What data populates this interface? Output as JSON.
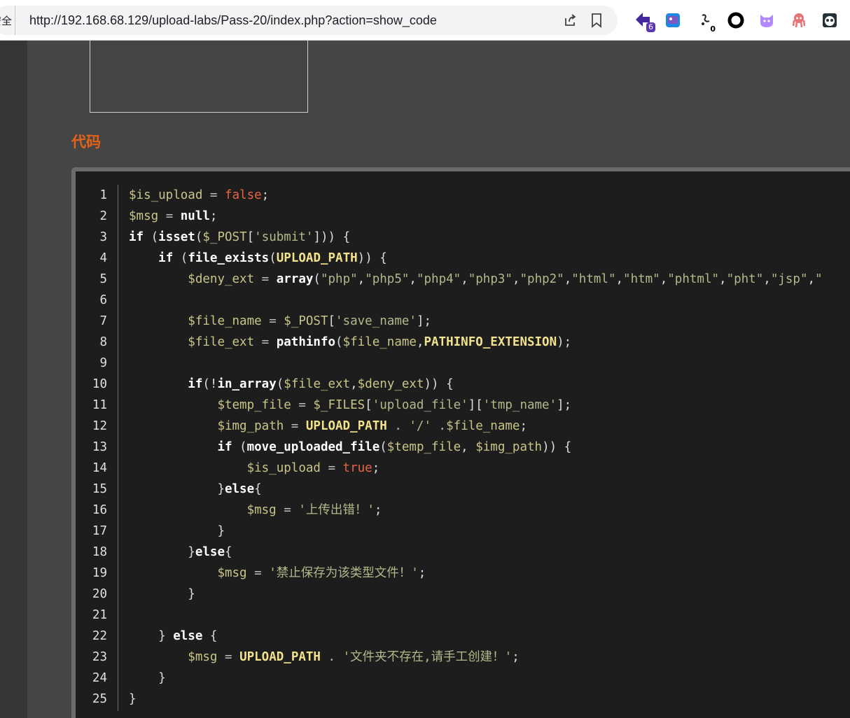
{
  "browser": {
    "security_label": "安全",
    "url": "http://192.168.68.129/upload-labs/Pass-20/index.php?action=show_code",
    "extension_badges": {
      "ext1": "6",
      "ext3": "0"
    },
    "icons": [
      "share-icon",
      "bookmark-icon",
      "extension-badge-icon",
      "extension-image-icon",
      "extension-script-icon",
      "extension-ring-icon",
      "extension-cat-icon",
      "extension-octopus-icon",
      "extension-panda-icon"
    ]
  },
  "section": {
    "title": "代码"
  },
  "code": {
    "lines": [
      {
        "n": "1",
        "tokens": [
          {
            "t": "$is_upload",
            "c": "var"
          },
          {
            "t": " = ",
            "c": "op"
          },
          {
            "t": "false",
            "c": "bool"
          },
          {
            "t": ";",
            "c": "plain"
          }
        ]
      },
      {
        "n": "2",
        "tokens": [
          {
            "t": "$msg",
            "c": "var"
          },
          {
            "t": " = ",
            "c": "op"
          },
          {
            "t": "null",
            "c": "kw"
          },
          {
            "t": ";",
            "c": "plain"
          }
        ]
      },
      {
        "n": "3",
        "tokens": [
          {
            "t": "if",
            "c": "kw"
          },
          {
            "t": " (",
            "c": "plain"
          },
          {
            "t": "isset",
            "c": "fn"
          },
          {
            "t": "(",
            "c": "plain"
          },
          {
            "t": "$_POST",
            "c": "var"
          },
          {
            "t": "[",
            "c": "plain"
          },
          {
            "t": "'submit'",
            "c": "str"
          },
          {
            "t": "])) {",
            "c": "plain"
          }
        ]
      },
      {
        "n": "4",
        "tokens": [
          {
            "t": "    ",
            "c": "plain"
          },
          {
            "t": "if",
            "c": "kw"
          },
          {
            "t": " (",
            "c": "plain"
          },
          {
            "t": "file_exists",
            "c": "fn"
          },
          {
            "t": "(",
            "c": "plain"
          },
          {
            "t": "UPLOAD_PATH",
            "c": "const"
          },
          {
            "t": ")) {",
            "c": "plain"
          }
        ]
      },
      {
        "n": "5",
        "tokens": [
          {
            "t": "        ",
            "c": "plain"
          },
          {
            "t": "$deny_ext",
            "c": "var"
          },
          {
            "t": " = ",
            "c": "op"
          },
          {
            "t": "array",
            "c": "fn"
          },
          {
            "t": "(",
            "c": "plain"
          },
          {
            "t": "\"php\"",
            "c": "str"
          },
          {
            "t": ",",
            "c": "plain"
          },
          {
            "t": "\"php5\"",
            "c": "str"
          },
          {
            "t": ",",
            "c": "plain"
          },
          {
            "t": "\"php4\"",
            "c": "str"
          },
          {
            "t": ",",
            "c": "plain"
          },
          {
            "t": "\"php3\"",
            "c": "str"
          },
          {
            "t": ",",
            "c": "plain"
          },
          {
            "t": "\"php2\"",
            "c": "str"
          },
          {
            "t": ",",
            "c": "plain"
          },
          {
            "t": "\"html\"",
            "c": "str"
          },
          {
            "t": ",",
            "c": "plain"
          },
          {
            "t": "\"htm\"",
            "c": "str"
          },
          {
            "t": ",",
            "c": "plain"
          },
          {
            "t": "\"phtml\"",
            "c": "str"
          },
          {
            "t": ",",
            "c": "plain"
          },
          {
            "t": "\"pht\"",
            "c": "str"
          },
          {
            "t": ",",
            "c": "plain"
          },
          {
            "t": "\"jsp\"",
            "c": "str"
          },
          {
            "t": ",",
            "c": "plain"
          },
          {
            "t": "\"",
            "c": "str"
          }
        ]
      },
      {
        "n": "6",
        "tokens": []
      },
      {
        "n": "7",
        "tokens": [
          {
            "t": "        ",
            "c": "plain"
          },
          {
            "t": "$file_name",
            "c": "var"
          },
          {
            "t": " = ",
            "c": "op"
          },
          {
            "t": "$_POST",
            "c": "var"
          },
          {
            "t": "[",
            "c": "plain"
          },
          {
            "t": "'save_name'",
            "c": "str"
          },
          {
            "t": "];",
            "c": "plain"
          }
        ]
      },
      {
        "n": "8",
        "tokens": [
          {
            "t": "        ",
            "c": "plain"
          },
          {
            "t": "$file_ext",
            "c": "var"
          },
          {
            "t": " = ",
            "c": "op"
          },
          {
            "t": "pathinfo",
            "c": "fn"
          },
          {
            "t": "(",
            "c": "plain"
          },
          {
            "t": "$file_name",
            "c": "var"
          },
          {
            "t": ",",
            "c": "plain"
          },
          {
            "t": "PATHINFO_EXTENSION",
            "c": "const"
          },
          {
            "t": ");",
            "c": "plain"
          }
        ]
      },
      {
        "n": "9",
        "tokens": []
      },
      {
        "n": "10",
        "tokens": [
          {
            "t": "        ",
            "c": "plain"
          },
          {
            "t": "if",
            "c": "kw"
          },
          {
            "t": "(!",
            "c": "plain"
          },
          {
            "t": "in_array",
            "c": "fn"
          },
          {
            "t": "(",
            "c": "plain"
          },
          {
            "t": "$file_ext",
            "c": "var"
          },
          {
            "t": ",",
            "c": "plain"
          },
          {
            "t": "$deny_ext",
            "c": "var"
          },
          {
            "t": ")) {",
            "c": "plain"
          }
        ]
      },
      {
        "n": "11",
        "tokens": [
          {
            "t": "            ",
            "c": "plain"
          },
          {
            "t": "$temp_file",
            "c": "var"
          },
          {
            "t": " = ",
            "c": "op"
          },
          {
            "t": "$_FILES",
            "c": "var"
          },
          {
            "t": "[",
            "c": "plain"
          },
          {
            "t": "'upload_file'",
            "c": "str"
          },
          {
            "t": "][",
            "c": "plain"
          },
          {
            "t": "'tmp_name'",
            "c": "str"
          },
          {
            "t": "];",
            "c": "plain"
          }
        ]
      },
      {
        "n": "12",
        "tokens": [
          {
            "t": "            ",
            "c": "plain"
          },
          {
            "t": "$img_path",
            "c": "var"
          },
          {
            "t": " = ",
            "c": "op"
          },
          {
            "t": "UPLOAD_PATH",
            "c": "const"
          },
          {
            "t": " . ",
            "c": "op"
          },
          {
            "t": "'/'",
            "c": "str"
          },
          {
            "t": " .",
            "c": "op"
          },
          {
            "t": "$file_name",
            "c": "var"
          },
          {
            "t": ";",
            "c": "plain"
          }
        ]
      },
      {
        "n": "13",
        "tokens": [
          {
            "t": "            ",
            "c": "plain"
          },
          {
            "t": "if",
            "c": "kw"
          },
          {
            "t": " (",
            "c": "plain"
          },
          {
            "t": "move_uploaded_file",
            "c": "fn"
          },
          {
            "t": "(",
            "c": "plain"
          },
          {
            "t": "$temp_file",
            "c": "var"
          },
          {
            "t": ", ",
            "c": "plain"
          },
          {
            "t": "$img_path",
            "c": "var"
          },
          {
            "t": ")) {",
            "c": "plain"
          }
        ]
      },
      {
        "n": "14",
        "tokens": [
          {
            "t": "                ",
            "c": "plain"
          },
          {
            "t": "$is_upload",
            "c": "var"
          },
          {
            "t": " = ",
            "c": "op"
          },
          {
            "t": "true",
            "c": "bool"
          },
          {
            "t": ";",
            "c": "plain"
          }
        ]
      },
      {
        "n": "15",
        "tokens": [
          {
            "t": "            ",
            "c": "plain"
          },
          {
            "t": "}",
            "c": "plain"
          },
          {
            "t": "else",
            "c": "kw"
          },
          {
            "t": "{",
            "c": "plain"
          }
        ]
      },
      {
        "n": "16",
        "tokens": [
          {
            "t": "                ",
            "c": "plain"
          },
          {
            "t": "$msg",
            "c": "var"
          },
          {
            "t": " = ",
            "c": "op"
          },
          {
            "t": "'上传出错！'",
            "c": "str"
          },
          {
            "t": ";",
            "c": "plain"
          }
        ]
      },
      {
        "n": "17",
        "tokens": [
          {
            "t": "            ",
            "c": "plain"
          },
          {
            "t": "}",
            "c": "plain"
          }
        ]
      },
      {
        "n": "18",
        "tokens": [
          {
            "t": "        ",
            "c": "plain"
          },
          {
            "t": "}",
            "c": "plain"
          },
          {
            "t": "else",
            "c": "kw"
          },
          {
            "t": "{",
            "c": "plain"
          }
        ]
      },
      {
        "n": "19",
        "tokens": [
          {
            "t": "            ",
            "c": "plain"
          },
          {
            "t": "$msg",
            "c": "var"
          },
          {
            "t": " = ",
            "c": "op"
          },
          {
            "t": "'禁止保存为该类型文件！'",
            "c": "str"
          },
          {
            "t": ";",
            "c": "plain"
          }
        ]
      },
      {
        "n": "20",
        "tokens": [
          {
            "t": "        ",
            "c": "plain"
          },
          {
            "t": "}",
            "c": "plain"
          }
        ]
      },
      {
        "n": "21",
        "tokens": []
      },
      {
        "n": "22",
        "tokens": [
          {
            "t": "    ",
            "c": "plain"
          },
          {
            "t": "} ",
            "c": "plain"
          },
          {
            "t": "else",
            "c": "kw"
          },
          {
            "t": " {",
            "c": "plain"
          }
        ]
      },
      {
        "n": "23",
        "tokens": [
          {
            "t": "        ",
            "c": "plain"
          },
          {
            "t": "$msg",
            "c": "var"
          },
          {
            "t": " = ",
            "c": "op"
          },
          {
            "t": "UPLOAD_PATH",
            "c": "const"
          },
          {
            "t": " . ",
            "c": "op"
          },
          {
            "t": "'文件夹不存在,请手工创建！'",
            "c": "str"
          },
          {
            "t": ";",
            "c": "plain"
          }
        ]
      },
      {
        "n": "24",
        "tokens": [
          {
            "t": "    ",
            "c": "plain"
          },
          {
            "t": "}",
            "c": "plain"
          }
        ]
      },
      {
        "n": "25",
        "tokens": [
          {
            "t": "}",
            "c": "plain"
          }
        ]
      }
    ]
  }
}
